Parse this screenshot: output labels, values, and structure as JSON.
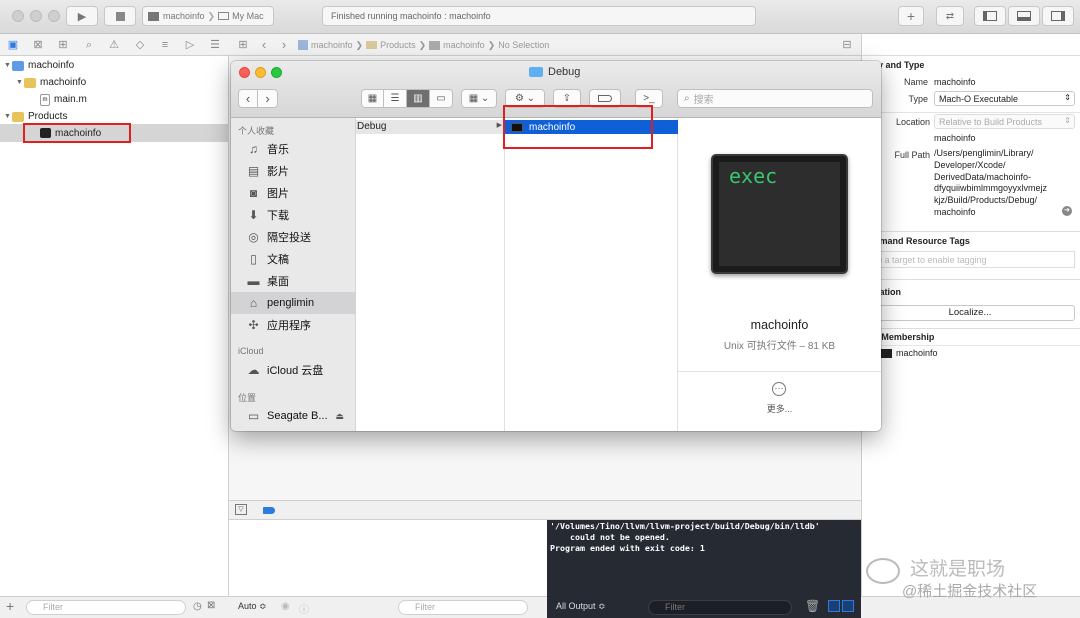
{
  "toolbar": {
    "scheme": "machoinfo",
    "destination": "My Mac",
    "status": "Finished running machoinfo : machoinfo"
  },
  "breadcrumb": [
    "machoinfo",
    "Products",
    "machoinfo",
    "No Selection"
  ],
  "navigator": {
    "items": [
      {
        "label": "machoinfo",
        "kind": "project"
      },
      {
        "label": "machoinfo",
        "kind": "folder"
      },
      {
        "label": "main.m",
        "kind": "m-file"
      },
      {
        "label": "Products",
        "kind": "folder"
      },
      {
        "label": "machoinfo",
        "kind": "exec"
      }
    ],
    "filter_placeholder": "Filter"
  },
  "finder": {
    "title": "Debug",
    "search_placeholder": "搜索",
    "sidebar": {
      "favorites_header": "个人收藏",
      "favorites": [
        {
          "label": "音乐",
          "icon": "music-icon"
        },
        {
          "label": "影片",
          "icon": "movie-icon"
        },
        {
          "label": "图片",
          "icon": "camera-icon"
        },
        {
          "label": "下载",
          "icon": "download-icon"
        },
        {
          "label": "隔空投送",
          "icon": "airdrop-icon"
        },
        {
          "label": "文稿",
          "icon": "document-icon"
        },
        {
          "label": "桌面",
          "icon": "desktop-icon"
        },
        {
          "label": "penglimin",
          "icon": "home-icon"
        },
        {
          "label": "应用程序",
          "icon": "apps-icon"
        }
      ],
      "icloud_header": "iCloud",
      "icloud": [
        {
          "label": "iCloud 云盘",
          "icon": "cloud-icon"
        }
      ],
      "locations_header": "位置",
      "locations": [
        {
          "label": "Seagate B...",
          "icon": "drive-icon"
        }
      ]
    },
    "col1": "Debug",
    "col2": "machoinfo",
    "preview": {
      "icon_text": "exec",
      "name": "machoinfo",
      "kind": "Unix 可执行文件 – 81 KB",
      "more": "更多..."
    }
  },
  "inspector": {
    "identity_title": "Identity and Type",
    "name_label": "Name",
    "name_value": "machoinfo",
    "type_label": "Type",
    "type_value": "Mach-O Executable",
    "location_label": "Location",
    "location_value": "Relative to Build Products",
    "location_file": "machoinfo",
    "fullpath_label": "Full Path",
    "fullpath_lines": [
      "/Users/penglimin/Library/",
      "Developer/Xcode/",
      "DerivedData/machoinfo-",
      "dfyquiiwbimlmmgoyyxlvmejz",
      "kjz/Build/Products/Debug/",
      "machoinfo"
    ],
    "odr_title": "On Demand Resource Tags",
    "odr_placeholder": "Add to a target to enable tagging",
    "loc_title": "Localization",
    "localize_button": "Localize...",
    "target_title": "Target Membership",
    "target_item": "machoinfo"
  },
  "debug": {
    "console_lines": [
      "'/Volumes/Tino/llvm/llvm-project/build/Debug/bin/lldb'",
      "    could not be opened.",
      "Program ended with exit code: 1"
    ],
    "auto_label": "Auto ≎",
    "vars_filter": "Filter",
    "output_label": "All Output ≎",
    "console_filter": "Filter"
  },
  "watermark": {
    "line1": "这就是职场",
    "line2": "@稀土掘金技术社区"
  },
  "colors": {
    "selection": "#0f5fd6",
    "highlight_box": "#e02020",
    "exec_green": "#38c76b"
  }
}
